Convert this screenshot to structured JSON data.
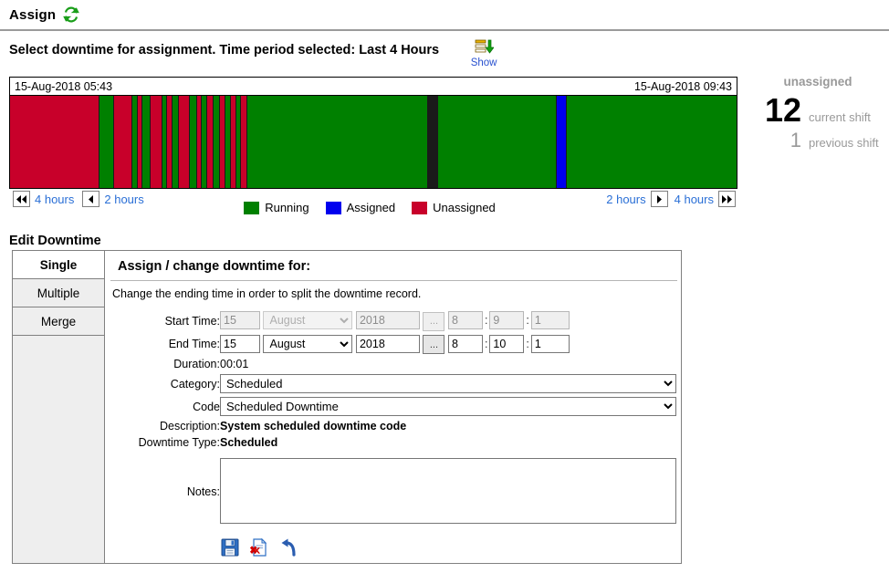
{
  "header": {
    "title": "Assign",
    "refresh_icon": "refresh-sync-icon"
  },
  "instruction": {
    "text": "Select downtime for assignment. Time period selected: Last 4 Hours",
    "show_label": "Show",
    "show_icon": "export-download-icon"
  },
  "timeline": {
    "start_time": "15-Aug-2018 05:43",
    "end_time": "15-Aug-2018 09:43",
    "segments": [
      {
        "type": "unassigned",
        "width": 12.3
      },
      {
        "type": "running",
        "width": 1.9
      },
      {
        "type": "unassigned",
        "width": 2.4
      },
      {
        "type": "running",
        "width": 0.7
      },
      {
        "type": "unassigned",
        "width": 0.5
      },
      {
        "type": "running",
        "width": 1.0
      },
      {
        "type": "unassigned",
        "width": 1.5
      },
      {
        "type": "running",
        "width": 0.6
      },
      {
        "type": "unassigned",
        "width": 0.6
      },
      {
        "type": "running",
        "width": 0.7
      },
      {
        "type": "unassigned",
        "width": 1.4
      },
      {
        "type": "running",
        "width": 0.9
      },
      {
        "type": "unassigned",
        "width": 0.6
      },
      {
        "type": "running",
        "width": 0.6
      },
      {
        "type": "unassigned",
        "width": 0.8
      },
      {
        "type": "running",
        "width": 0.7
      },
      {
        "type": "unassigned",
        "width": 0.7
      },
      {
        "type": "running",
        "width": 0.6
      },
      {
        "type": "unassigned",
        "width": 0.6
      },
      {
        "type": "running",
        "width": 0.6
      },
      {
        "type": "unassigned",
        "width": 0.7
      },
      {
        "type": "running",
        "width": 25.0
      },
      {
        "type": "assigned-selected",
        "width": 1.3
      },
      {
        "type": "running",
        "width": 16.4
      },
      {
        "type": "assigned",
        "width": 1.3
      },
      {
        "type": "running",
        "width": 23.6
      }
    ],
    "nav": {
      "back_4": "4 hours",
      "back_2": "2 hours",
      "fwd_2": "2 hours",
      "fwd_4": "4 hours",
      "back_4_icon": "double-left-arrow-icon",
      "back_2_icon": "left-arrow-icon",
      "fwd_2_icon": "right-arrow-icon",
      "fwd_4_icon": "double-right-arrow-icon"
    },
    "legend": [
      {
        "label": "Running",
        "color": "#008000"
      },
      {
        "label": "Assigned",
        "color": "#0000EE"
      },
      {
        "label": "Unassigned",
        "color": "#C8002A"
      }
    ]
  },
  "stats": {
    "title": "unassigned",
    "current_value": "12",
    "current_label": "current shift",
    "previous_value": "1",
    "previous_label": "previous shift"
  },
  "edit": {
    "heading": "Edit Downtime",
    "tabs": [
      {
        "label": "Single",
        "active": true
      },
      {
        "label": "Multiple",
        "active": false
      },
      {
        "label": "Merge",
        "active": false
      }
    ],
    "form_title": "Assign / change downtime for:",
    "form_subtitle": "Change the ending time in order to split the downtime record.",
    "start_time": {
      "label": "Start Time:",
      "day": "15",
      "month": "August",
      "year": "2018",
      "picker_label": "...",
      "hour": "8",
      "minute": "9",
      "second": "1",
      "disabled": true
    },
    "end_time": {
      "label": "End Time:",
      "day": "15",
      "month": "August",
      "year": "2018",
      "picker_label": "...",
      "hour": "8",
      "minute": "10",
      "second": "1",
      "disabled": false
    },
    "duration": {
      "label": "Duration:",
      "value": "00:01"
    },
    "category": {
      "label": "Category:",
      "value": "Scheduled"
    },
    "code": {
      "label": "Code",
      "value": "Scheduled Downtime"
    },
    "description": {
      "label": "Description:",
      "value": "System scheduled downtime code"
    },
    "downtime_type": {
      "label": "Downtime Type:",
      "value": "Scheduled"
    },
    "notes": {
      "label": "Notes:",
      "value": ""
    },
    "actions": [
      {
        "name": "save-icon",
        "title": "Save"
      },
      {
        "name": "delete-icon",
        "title": "Delete"
      },
      {
        "name": "undo-icon",
        "title": "Undo"
      }
    ]
  }
}
